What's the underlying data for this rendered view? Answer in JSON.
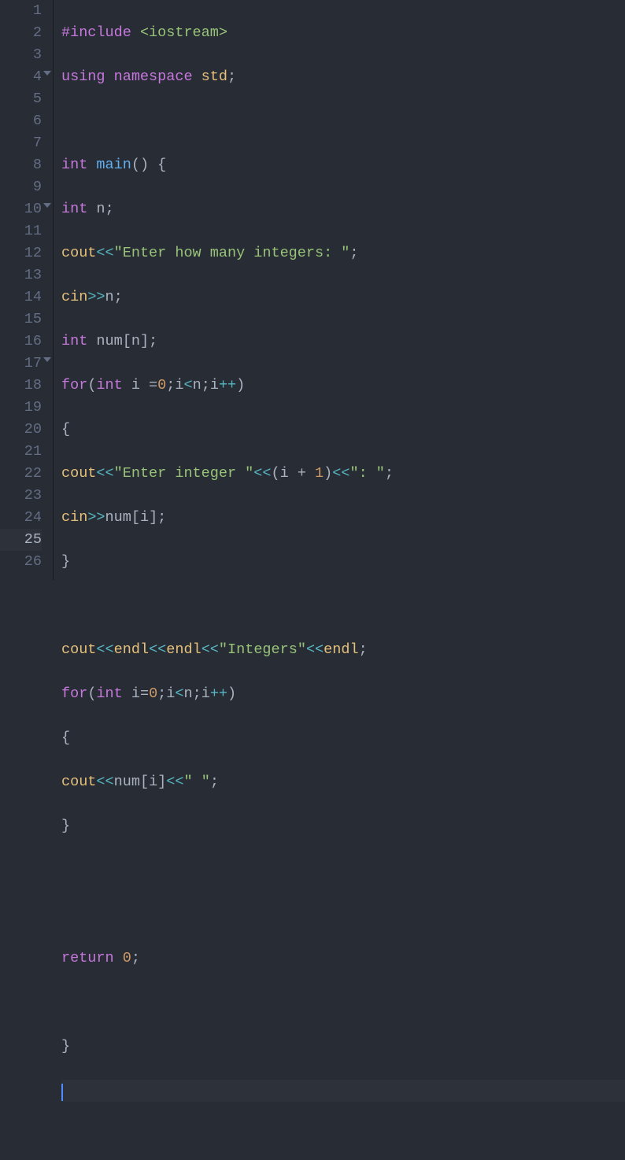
{
  "gutter": {
    "lines": [
      "1",
      "2",
      "3",
      "4",
      "5",
      "6",
      "7",
      "8",
      "9",
      "10",
      "11",
      "12",
      "13",
      "14",
      "15",
      "16",
      "17",
      "18",
      "19",
      "20",
      "21",
      "22",
      "23",
      "24",
      "25",
      "26"
    ],
    "foldLines": [
      4,
      10,
      17
    ],
    "activeLine": 25
  },
  "code": {
    "l1": {
      "a": "#include",
      "b": " ",
      "c": "<iostream>"
    },
    "l2": {
      "a": "using",
      "b": " ",
      "c": "namespace",
      "d": " ",
      "e": "std",
      "f": ";"
    },
    "l3": "",
    "l4": {
      "a": "int",
      "b": " ",
      "c": "main",
      "d": "()",
      "e": " {"
    },
    "l5": {
      "a": "int",
      "b": " ",
      "c": "n",
      "d": ";"
    },
    "l6": {
      "a": "cout",
      "b": "<<",
      "c": "\"Enter how many integers: \"",
      "d": ";"
    },
    "l7": {
      "a": "cin",
      "b": ">>",
      "c": "n",
      "d": ";"
    },
    "l8": {
      "a": "int",
      "b": " ",
      "c": "num",
      "d": "[",
      "e": "n",
      "f": "];"
    },
    "l9": {
      "a": "for",
      "b": "(",
      "c": "int",
      "d": " ",
      "e": "i",
      "f": " =",
      "g": "0",
      "h": ";",
      "i": "i",
      "j": "<",
      "k": "n",
      "l": ";",
      "m": "i",
      "n": "++",
      "o": ")"
    },
    "l10": "{",
    "l11": {
      "a": "cout",
      "b": "<<",
      "c": "\"Enter integer \"",
      "d": "<<",
      "e": "(",
      "f": "i",
      "g": " + ",
      "h": "1",
      "i": ")",
      "j": "<<",
      "k": "\": \"",
      "l": ";"
    },
    "l12": {
      "a": "cin",
      "b": ">>",
      "c": "num",
      "d": "[",
      "e": "i",
      "f": "];"
    },
    "l13": "}",
    "l14": "",
    "l15": {
      "a": "cout",
      "b": "<<",
      "c": "endl",
      "d": "<<",
      "e": "endl",
      "f": "<<",
      "g": "\"Integers\"",
      "h": "<<",
      "i": "endl",
      "j": ";"
    },
    "l16": {
      "a": "for",
      "b": "(",
      "c": "int",
      "d": " ",
      "e": "i",
      "f": "=",
      "g": "0",
      "h": ";",
      "i": "i",
      "j": "<",
      "k": "n",
      "l": ";",
      "m": "i",
      "n": "++",
      "o": ")"
    },
    "l17": "{",
    "l18": {
      "a": "cout",
      "b": "<<",
      "c": "num",
      "d": "[",
      "e": "i",
      "f": "]",
      "g": "<<",
      "h": "\" \"",
      "i": ";"
    },
    "l19": "}",
    "l20": "",
    "l21": "",
    "l22": {
      "a": "return",
      "b": " ",
      "c": "0",
      "d": ";"
    },
    "l23": "",
    "l24": "}",
    "l25": "",
    "l26": ""
  }
}
